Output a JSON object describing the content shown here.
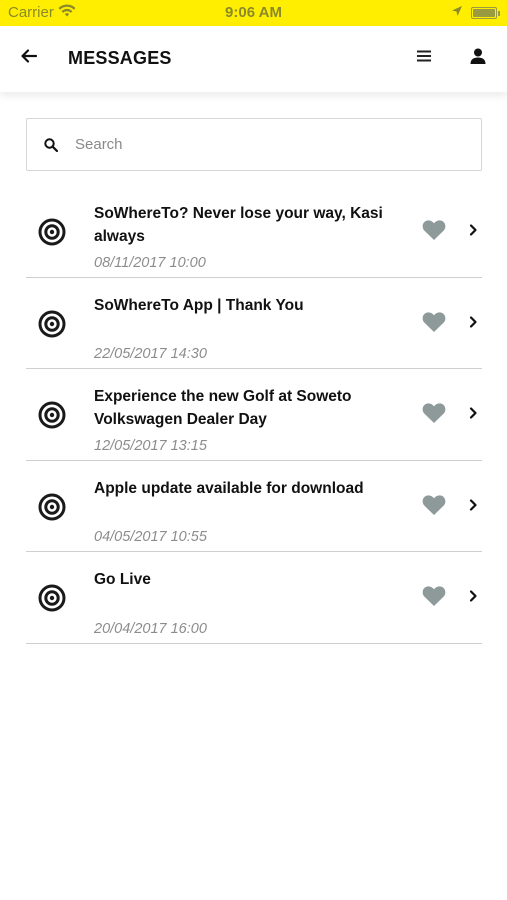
{
  "status_bar": {
    "carrier": "Carrier",
    "time": "9:06 AM",
    "wifi_icon": "wifi-icon",
    "location_icon": "location-arrow-icon",
    "battery_icon": "battery-icon",
    "battery_level": 1.0
  },
  "header": {
    "title": "MESSAGES",
    "back_icon": "arrow-left-icon",
    "menu_icon": "menu-icon",
    "user_icon": "user-icon"
  },
  "search": {
    "placeholder": "Search",
    "value": ""
  },
  "messages": [
    {
      "title": "SoWhereTo? Never lose your way, Kasi always",
      "date": "08/11/2017 10:00"
    },
    {
      "title": "SoWhereTo App | Thank You",
      "date": "22/05/2017 14:30"
    },
    {
      "title": "Experience the new Golf at Soweto Volkswagen Dealer Day",
      "date": "12/05/2017 13:15"
    },
    {
      "title": "Apple update available for download",
      "date": "04/05/2017 10:55"
    },
    {
      "title": "Go Live",
      "date": "20/04/2017 16:00"
    }
  ],
  "colors": {
    "status_bar_bg": "#ffee00",
    "heart": "#8e9a9a",
    "date_text": "#8c8c8c",
    "divider": "#cfcfcf"
  }
}
